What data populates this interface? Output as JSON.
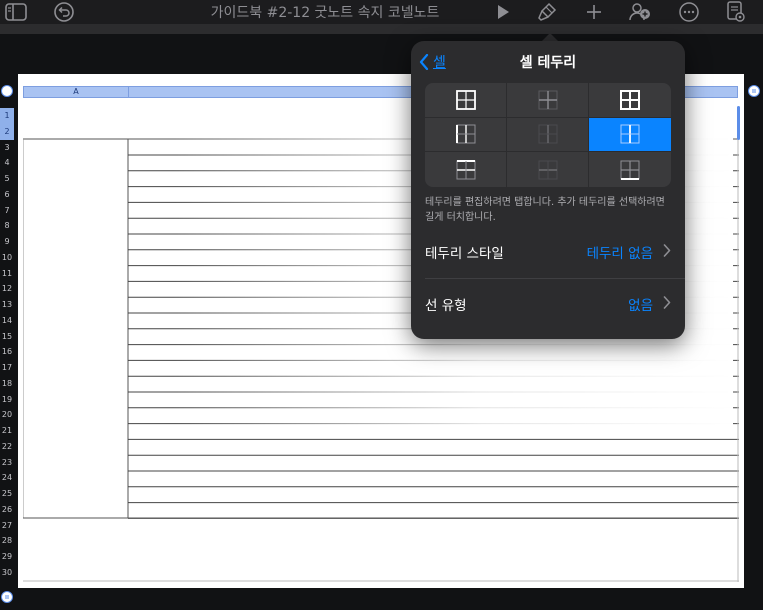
{
  "toolbar": {
    "document_title": "가이드북 #2-12 굿노트 속지 코넬노트",
    "icons": [
      "sidebar-icon",
      "undo-icon",
      "play-icon",
      "paintbrush-icon",
      "plus-icon",
      "collaborate-icon",
      "more-icon",
      "document-options-icon"
    ]
  },
  "sheet": {
    "column_header": "A",
    "row_numbers": [
      "1",
      "2",
      "3",
      "4",
      "5",
      "6",
      "7",
      "8",
      "9",
      "10",
      "11",
      "12",
      "13",
      "14",
      "15",
      "16",
      "17",
      "18",
      "19",
      "20",
      "21",
      "22",
      "23",
      "24",
      "25",
      "26",
      "27",
      "28",
      "29",
      "30"
    ],
    "selected_rows": [
      "1",
      "2"
    ]
  },
  "popover": {
    "back_label": "셀",
    "title": "셀 테두리",
    "border_options": [
      "all-borders",
      "inner-borders",
      "outer-and-inner-borders",
      "left-and-inner",
      "inner-vertical-light",
      "vertical-inner-selected",
      "top-and-bottom",
      "inner-horizontal-light",
      "bottom-inner"
    ],
    "selected_option_index": 5,
    "help_text": "테두리를 편집하려면 탭합니다. 추가 테두리를 선택하려면 길게 터치합니다.",
    "rows": [
      {
        "label": "테두리 스타일",
        "value": "테두리 없음"
      },
      {
        "label": "선 유형",
        "value": "없음"
      }
    ]
  },
  "colors": {
    "accent": "#0a84ff",
    "popover_bg": "#2c2c2e",
    "column_header": "#a9c3f2"
  }
}
